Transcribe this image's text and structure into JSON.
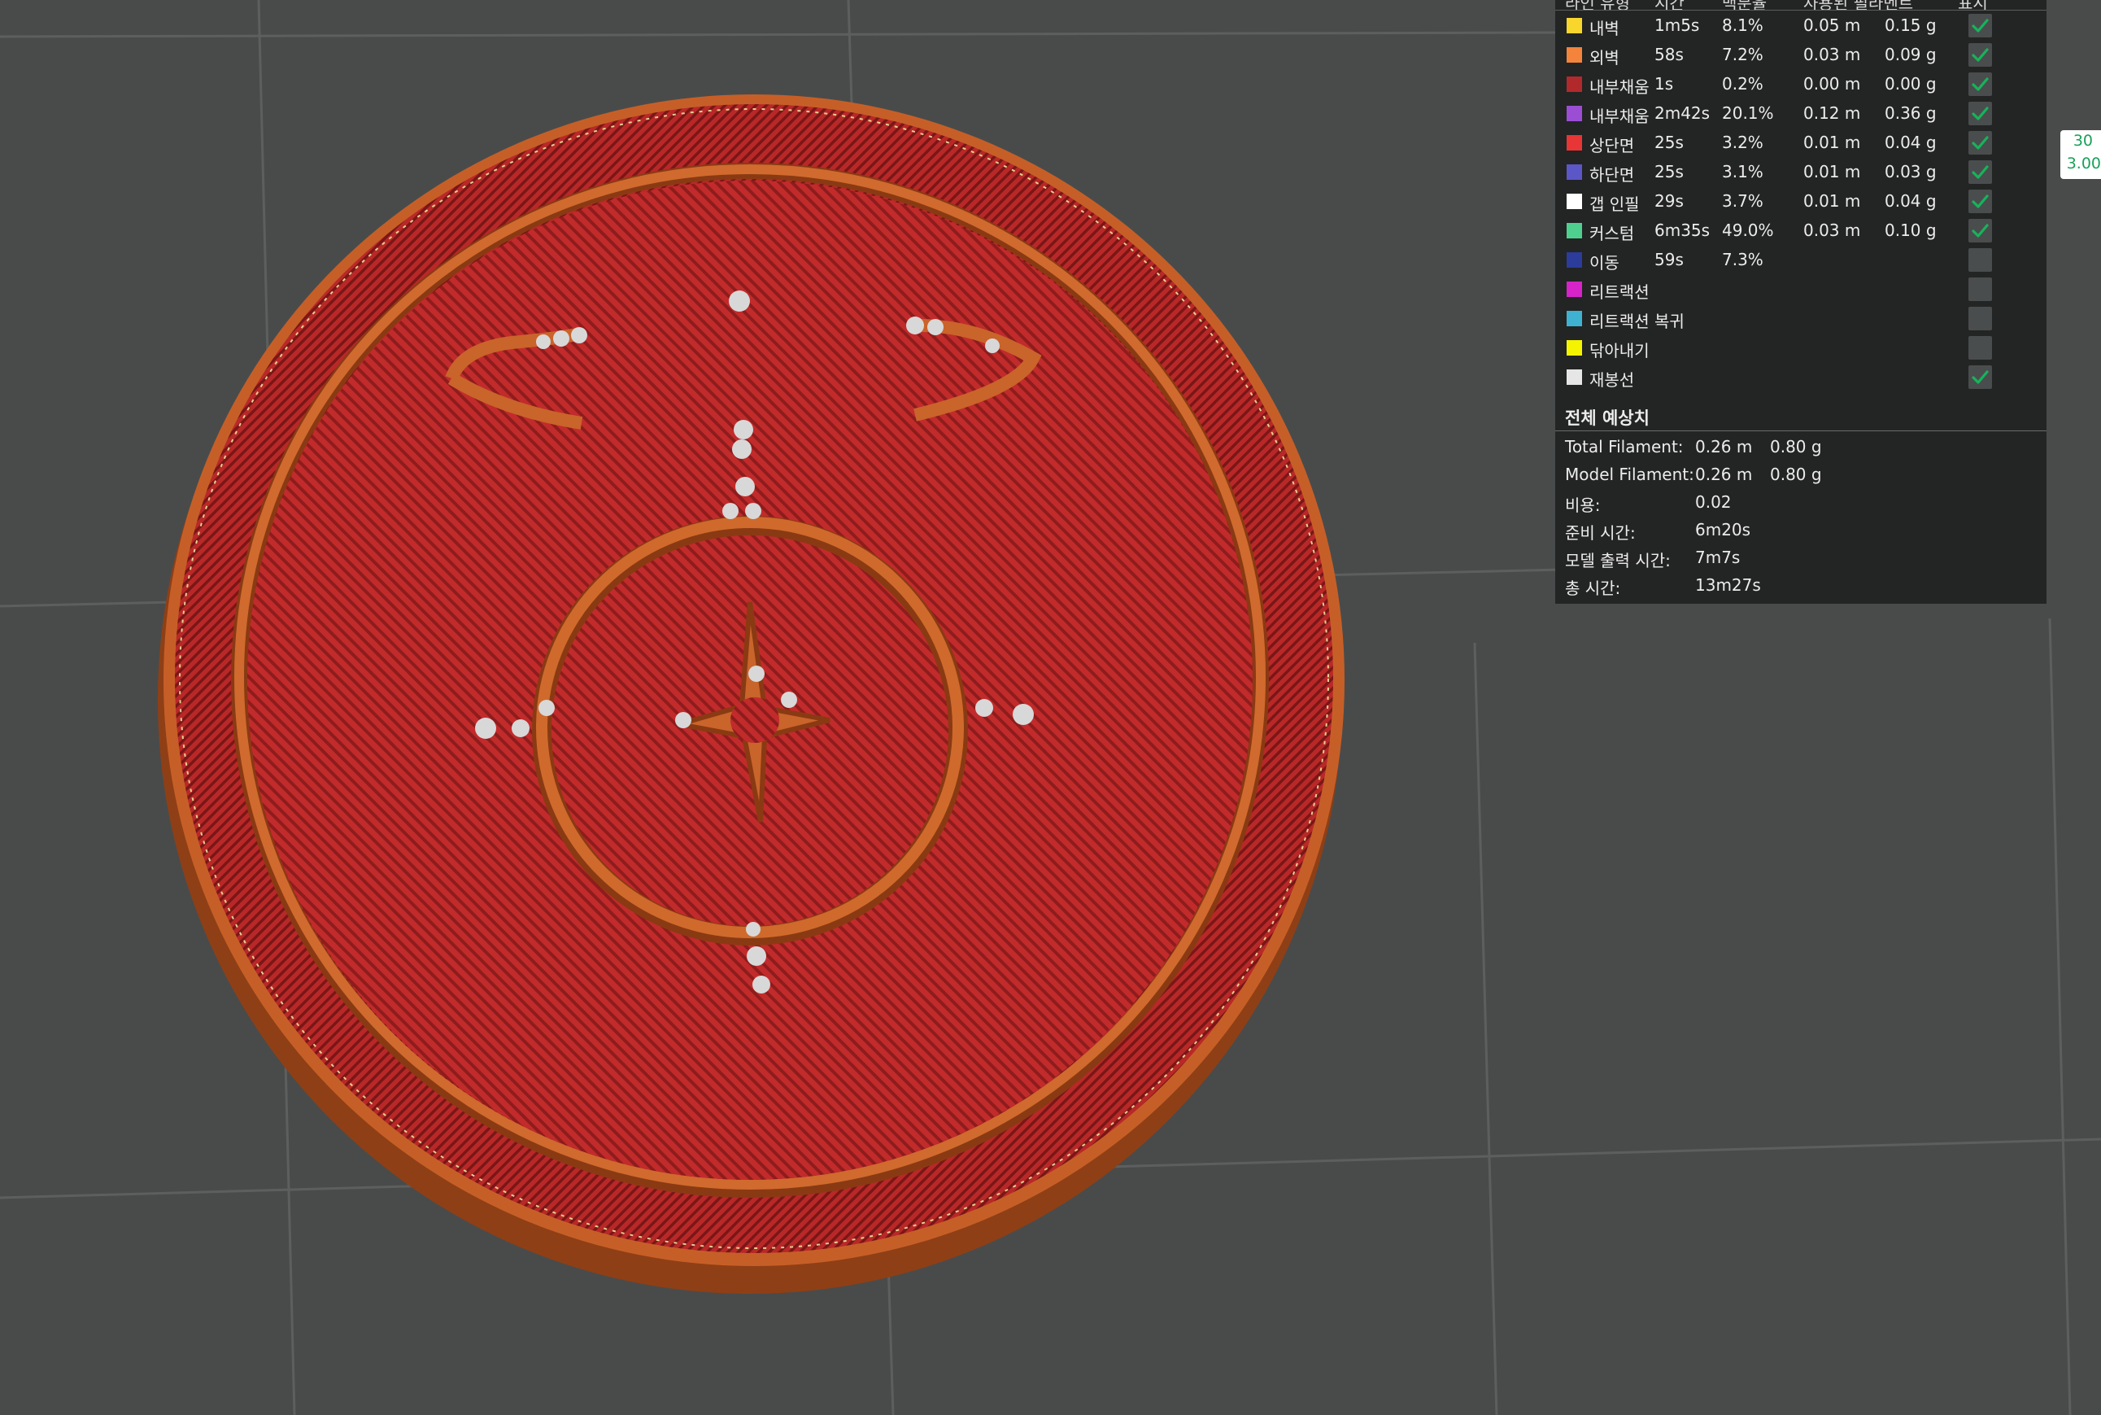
{
  "legend": {
    "header": [
      "라인 유형",
      "시간",
      "백분율",
      "사용된 필라멘트",
      "",
      "표시"
    ],
    "rows": [
      {
        "color": "#f9d62c",
        "name": "내벽",
        "time": "1m5s",
        "pct": "8.1%",
        "len": "0.05 m",
        "wt": "0.15 g",
        "shown": true
      },
      {
        "color": "#f4833b",
        "name": "외벽",
        "time": "58s",
        "pct": "7.2%",
        "len": "0.03 m",
        "wt": "0.09 g",
        "shown": true
      },
      {
        "color": "#b2292c",
        "name": "내부채움",
        "time": "1s",
        "pct": "0.2%",
        "len": "0.00 m",
        "wt": "0.00 g",
        "shown": true
      },
      {
        "color": "#9b4ed4",
        "name": "내부채움",
        "time": "2m42s",
        "pct": "20.1%",
        "len": "0.12 m",
        "wt": "0.36 g",
        "shown": true
      },
      {
        "color": "#e83535",
        "name": "상단면",
        "time": "25s",
        "pct": "3.2%",
        "len": "0.01 m",
        "wt": "0.04 g",
        "shown": true
      },
      {
        "color": "#5b57c7",
        "name": "하단면",
        "time": "25s",
        "pct": "3.1%",
        "len": "0.01 m",
        "wt": "0.03 g",
        "shown": true
      },
      {
        "color": "#ffffff",
        "name": "갭 인필",
        "time": "29s",
        "pct": "3.7%",
        "len": "0.01 m",
        "wt": "0.04 g",
        "shown": true
      },
      {
        "color": "#4fcf8e",
        "name": "커스텀",
        "time": "6m35s",
        "pct": "49.0%",
        "len": "0.03 m",
        "wt": "0.10 g",
        "shown": true
      },
      {
        "color": "#2c3c9a",
        "name": "이동",
        "time": "59s",
        "pct": "7.3%",
        "len": "",
        "wt": "",
        "shown": false
      },
      {
        "color": "#d624c8",
        "name": "리트랙션",
        "time": "",
        "pct": "",
        "len": "",
        "wt": "",
        "shown": false
      },
      {
        "color": "#3fb2d2",
        "name": "리트랙션 복귀",
        "time": "",
        "pct": "",
        "len": "",
        "wt": "",
        "shown": false
      },
      {
        "color": "#f4f400",
        "name": "닦아내기",
        "time": "",
        "pct": "",
        "len": "",
        "wt": "",
        "shown": false
      },
      {
        "color": "#e6e6e6",
        "name": "재봉선",
        "time": "",
        "pct": "",
        "len": "",
        "wt": "",
        "shown": true
      }
    ],
    "section_title": "전체 예상치",
    "totals": [
      {
        "label": "Total Filament:",
        "v1": "0.26 m",
        "v2": "0.80 g"
      },
      {
        "label": "Model Filament:",
        "v1": "0.26 m",
        "v2": "0.80 g"
      },
      {
        "label": "비용:",
        "v1": "0.02",
        "v2": ""
      },
      {
        "label": "준비 시간:",
        "v1": "6m20s",
        "v2": ""
      },
      {
        "label": "모델 출력 시간:",
        "v1": "7m7s",
        "v2": ""
      },
      {
        "label": "총 시간:",
        "v1": "13m27s",
        "v2": ""
      }
    ]
  },
  "layer_slider": {
    "layer": "30",
    "height": "3.00"
  },
  "colors": {
    "background": "#494b4b",
    "grid": "#5d5f5f",
    "panel": "#232424",
    "model_top": "#c42d2d",
    "model_wall": "#c65f27",
    "seam": "#d8d8d8",
    "check": "#17b35a"
  }
}
